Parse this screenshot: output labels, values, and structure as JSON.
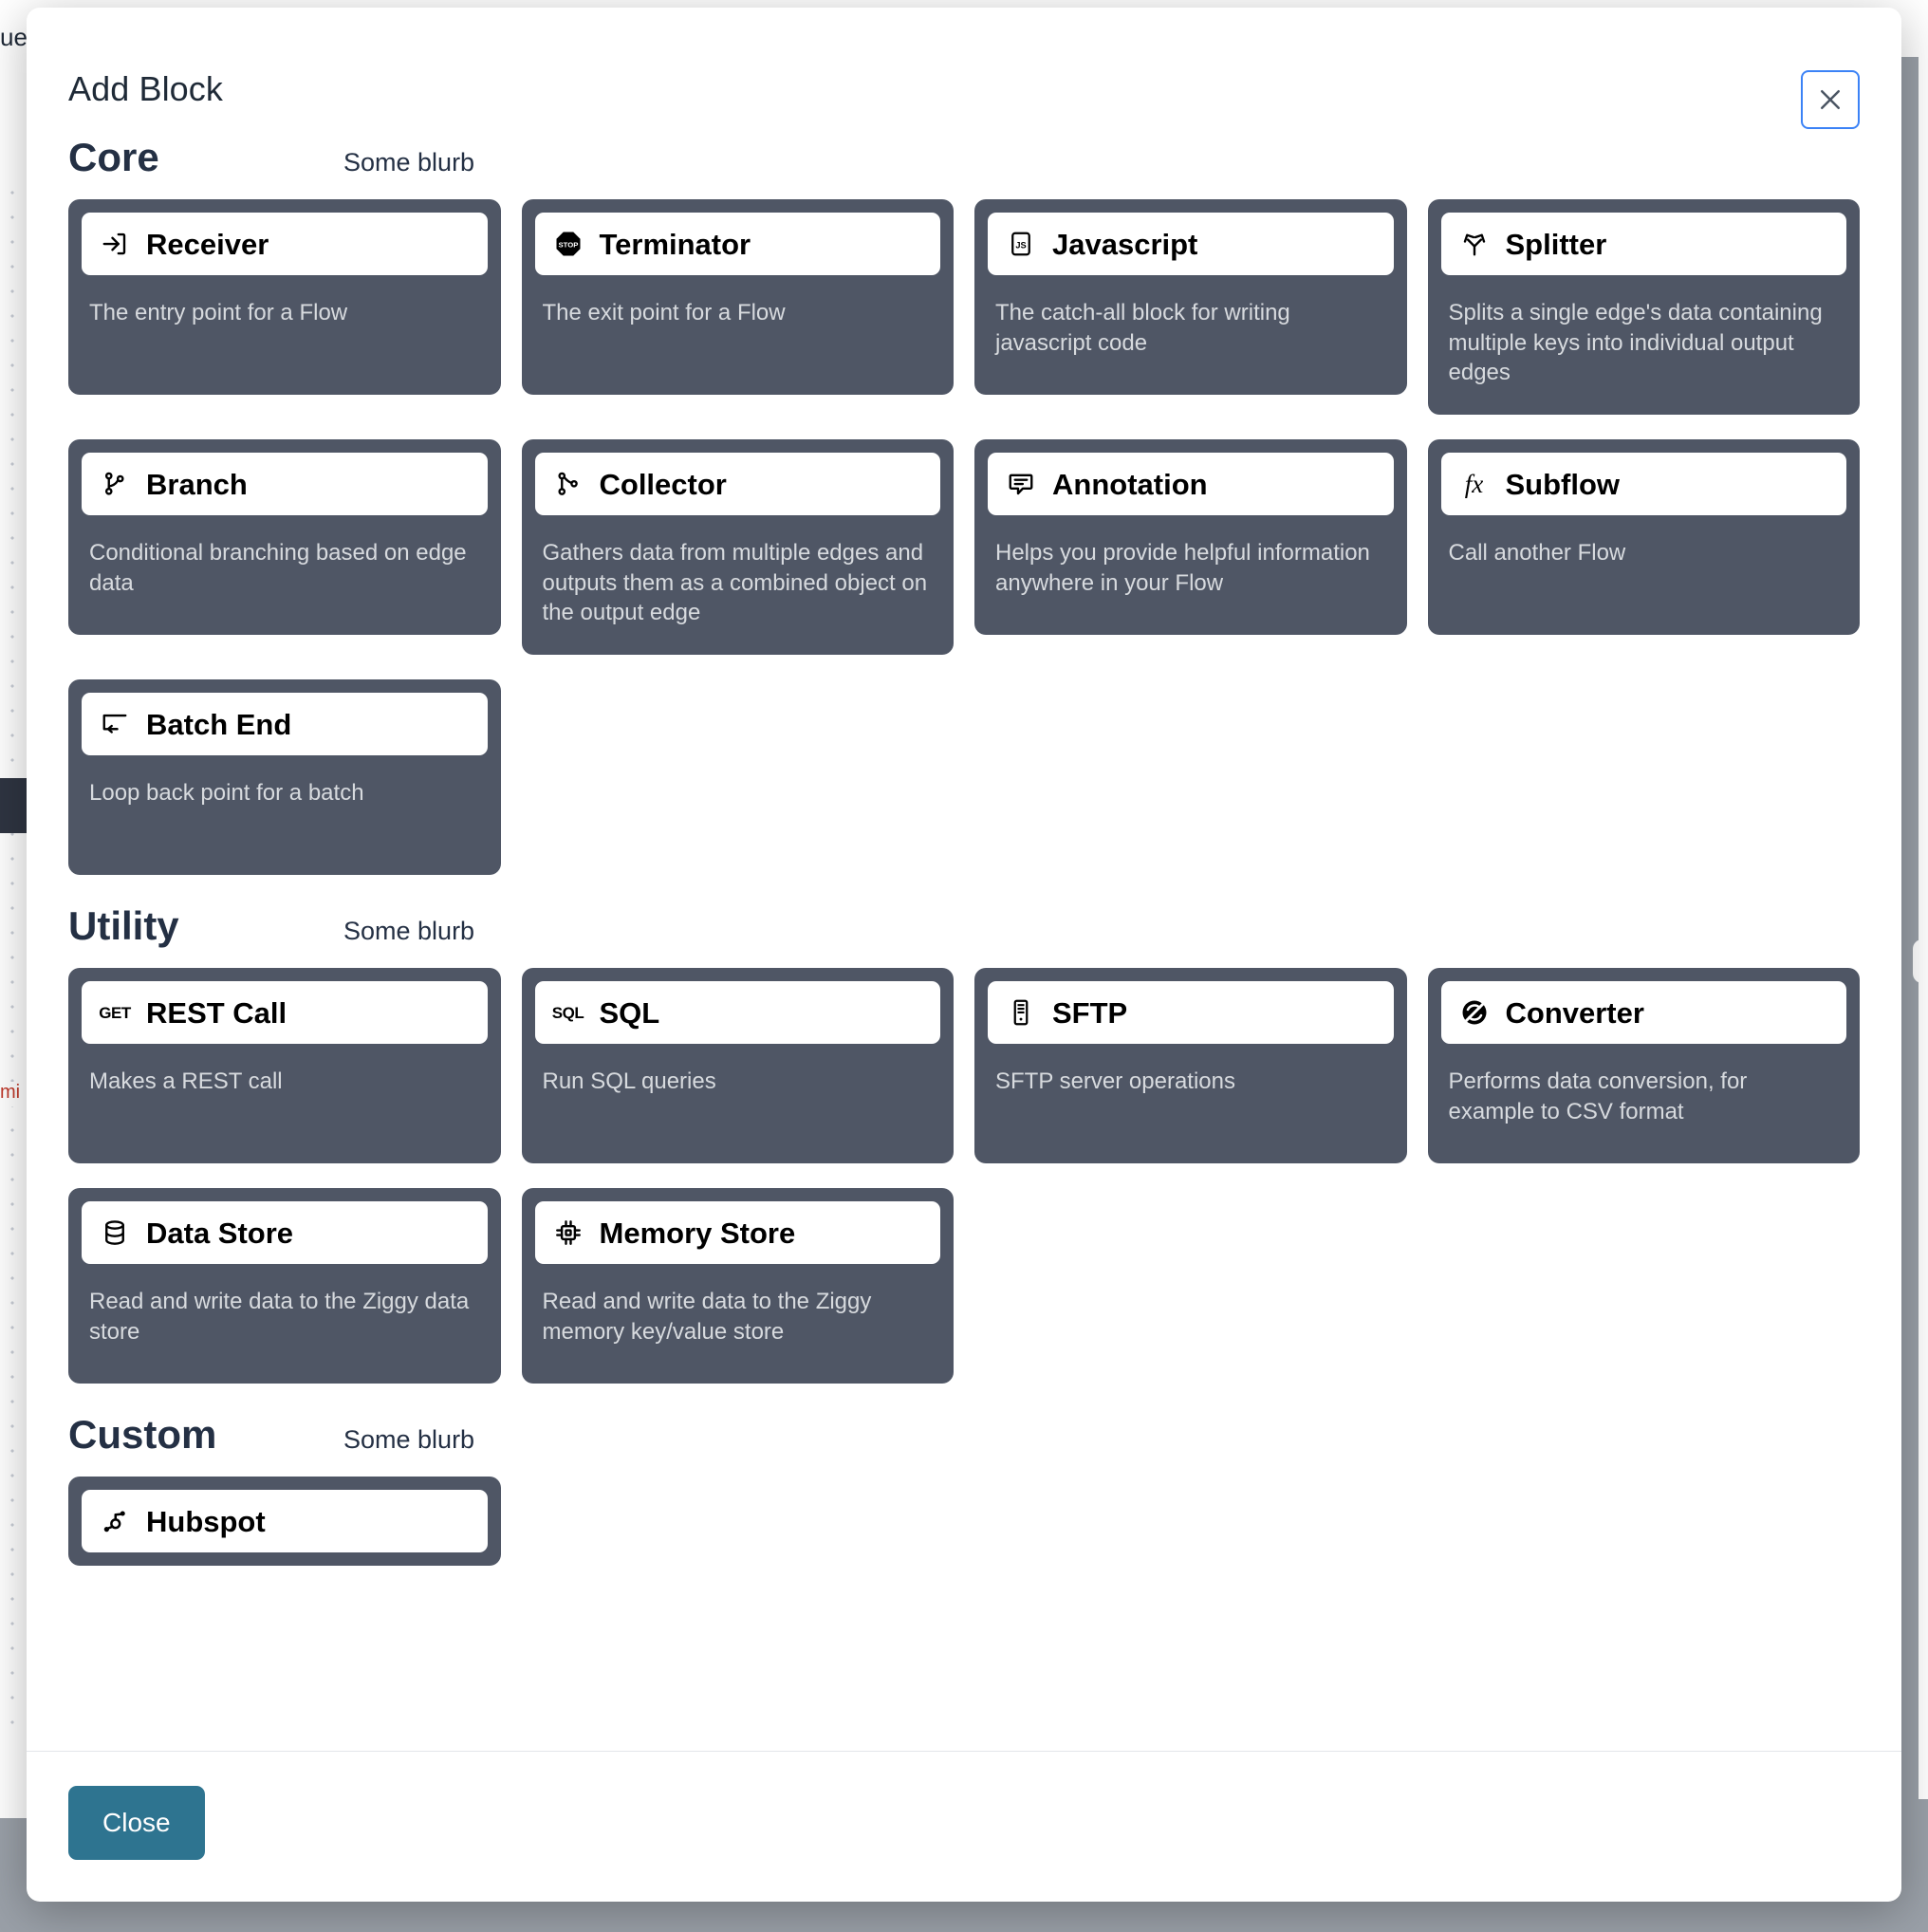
{
  "background": {
    "topbar_text": "ues",
    "error_text": "mi"
  },
  "modal": {
    "title": "Add Block",
    "close_icon_name": "close-icon",
    "footer": {
      "close_label": "Close"
    }
  },
  "colors": {
    "card_bg": "#4f5665",
    "card_head_bg": "#ffffff",
    "section_title": "#243044",
    "close_button_bg": "#2e7490",
    "close_x_border": "#3b82f6",
    "card_desc": "#d7dade"
  },
  "sections": [
    {
      "title": "Core",
      "blurb": "Some blurb",
      "blocks": [
        {
          "name": "Receiver",
          "icon": "login-arrow-icon",
          "desc": "The entry point for a Flow"
        },
        {
          "name": "Terminator",
          "icon": "stop-sign-icon",
          "desc": "The exit point for a Flow"
        },
        {
          "name": "Javascript",
          "icon": "js-badge-icon",
          "desc": "The catch-all block for writing javascript code"
        },
        {
          "name": "Splitter",
          "icon": "split-arrows-icon",
          "desc": "Splits a single edge's data containing multiple keys into individual output edges"
        },
        {
          "name": "Branch",
          "icon": "git-branch-icon",
          "desc": "Conditional branching based on edge data"
        },
        {
          "name": "Collector",
          "icon": "git-merge-icon",
          "desc": "Gathers data from multiple edges and outputs them as a combined object on the output edge"
        },
        {
          "name": "Annotation",
          "icon": "comment-icon",
          "desc": "Helps you provide helpful information anywhere in your Flow"
        },
        {
          "name": "Subflow",
          "icon": "fx-icon",
          "desc": "Call another Flow"
        },
        {
          "name": "Batch End",
          "icon": "loop-back-icon",
          "desc": "Loop back point for a batch"
        }
      ]
    },
    {
      "title": "Utility",
      "blurb": "Some blurb",
      "blocks": [
        {
          "name": "REST Call",
          "icon": "get-badge-icon",
          "desc": "Makes a REST call"
        },
        {
          "name": "SQL",
          "icon": "sql-badge-icon",
          "desc": "Run SQL queries"
        },
        {
          "name": "SFTP",
          "icon": "server-icon",
          "desc": "SFTP server operations"
        },
        {
          "name": "Converter",
          "icon": "convert-icon",
          "desc": "Performs data conversion, for example to CSV format"
        },
        {
          "name": "Data Store",
          "icon": "database-icon",
          "desc": "Read and write data to the Ziggy data store"
        },
        {
          "name": "Memory Store",
          "icon": "cpu-chip-icon",
          "desc": "Read and write data to the Ziggy memory key/value store"
        }
      ]
    },
    {
      "title": "Custom",
      "blurb": "Some blurb",
      "blocks": [
        {
          "name": "Hubspot",
          "icon": "hubspot-icon",
          "desc": ""
        }
      ]
    }
  ]
}
